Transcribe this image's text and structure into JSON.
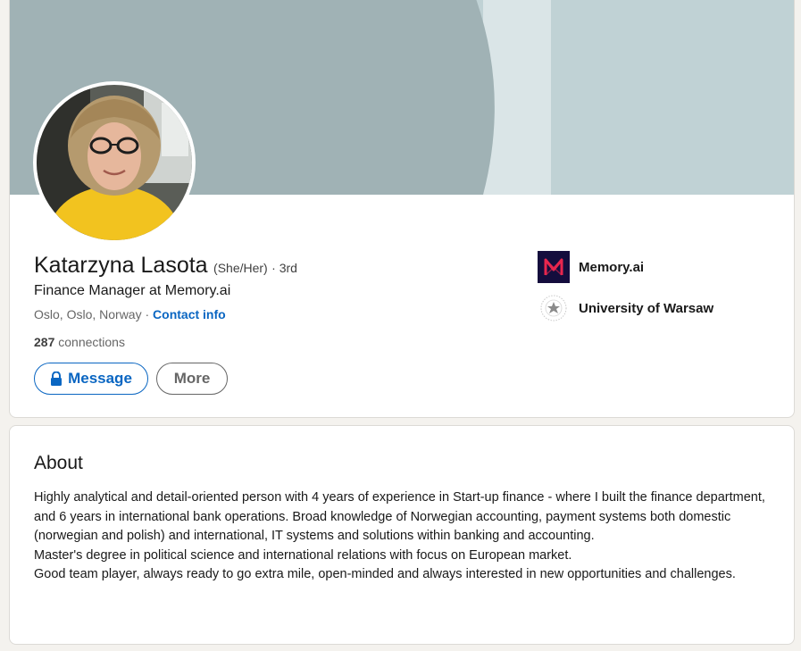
{
  "profile": {
    "name": "Katarzyna Lasota",
    "pronouns": "(She/Her)",
    "degree": "· 3rd",
    "headline": "Finance Manager at Memory.ai",
    "location": "Oslo, Oslo, Norway",
    "location_separator": " · ",
    "contact_link": "Contact info",
    "connections_count": "287",
    "connections_label": " connections",
    "message_button": "Message",
    "more_button": "More",
    "colors": {
      "banner_dark": "#a0b2b5",
      "banner_light": "#c0d2d5",
      "banner_strip": "#dae5e7",
      "link_blue": "#0a66c2",
      "memory_logo_bg": "#140d3d",
      "memory_logo_fg": "#e8264e"
    }
  },
  "experience": [
    {
      "label": "Memory.ai",
      "icon": "memory-ai-logo-icon"
    },
    {
      "label": "University of Warsaw",
      "icon": "university-of-warsaw-seal-icon"
    }
  ],
  "about": {
    "title": "About",
    "paragraphs": [
      "Highly analytical and detail-oriented person with 4 years of experience in Start-up finance - where I built the finance department, and 6 years in international bank operations. Broad knowledge of Norwegian accounting, payment systems both domestic (norwegian and polish) and international, IT systems and solutions within banking and accounting.",
      "Master's degree in political science and international relations with focus on European market.",
      "Good team player, always ready to go extra mile, open-minded and always interested in new opportunities and challenges."
    ]
  }
}
